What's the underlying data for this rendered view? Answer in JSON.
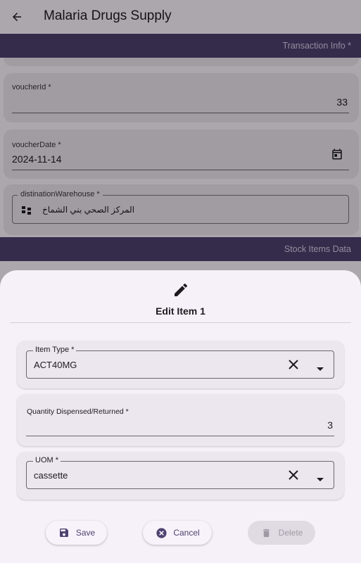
{
  "app": {
    "title": "Malaria Drugs Supply"
  },
  "sections": {
    "transaction": "Transaction Info *",
    "stock": "Stock Items Data"
  },
  "form": {
    "voucher_id": {
      "label": "voucherId *",
      "value": "33"
    },
    "voucher_date": {
      "label": "voucherDate *",
      "value": "2024-11-14"
    },
    "destination": {
      "label": "distinationWarehouse *",
      "value": "المركز الصحي بني الشماخ"
    }
  },
  "sheet": {
    "title": "Edit Item 1",
    "item_type": {
      "label": "Item Type *",
      "value": "ACT40MG"
    },
    "quantity": {
      "label": "Quantity Dispensed/Returned *",
      "value": "3"
    },
    "uom": {
      "label": "UOM *",
      "value": "cassette"
    },
    "buttons": {
      "save": "Save",
      "cancel": "Cancel",
      "delete": "Delete"
    }
  },
  "colors": {
    "primary": "#4f4270",
    "section_bar": "#4f4270",
    "surface": "#f6f1f8"
  },
  "icons": {
    "back": "arrow-back-icon",
    "calendar": "calendar-icon",
    "warehouse": "warehouse-icon",
    "edit": "pencil-icon",
    "clear": "close-icon",
    "dropdown": "caret-down-icon",
    "save": "floppy-disk-icon",
    "cancel": "cancel-circle-icon",
    "delete": "trash-icon"
  }
}
